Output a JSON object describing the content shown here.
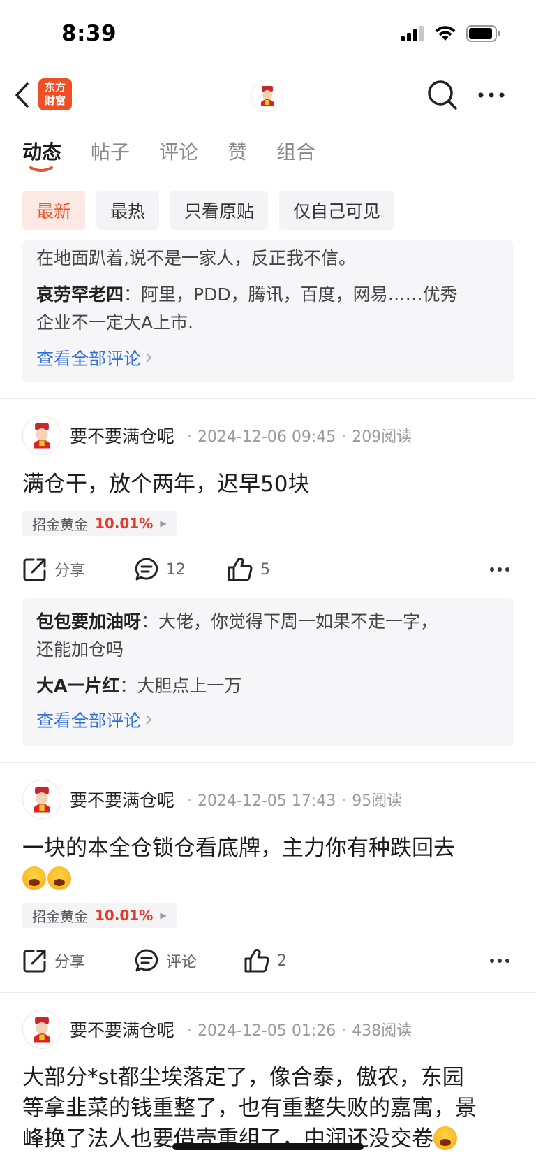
{
  "status_bar": {
    "time": "8:39"
  },
  "navbar": {
    "logo_text": "东方\n财富"
  },
  "tabs": [
    {
      "label": "动态"
    },
    {
      "label": "帖子"
    },
    {
      "label": "评论"
    },
    {
      "label": "赞"
    },
    {
      "label": "组合"
    }
  ],
  "filters": [
    {
      "label": "最新"
    },
    {
      "label": "最热"
    },
    {
      "label": "只看原贴"
    },
    {
      "label": "仅自己可见"
    }
  ],
  "top_comments": {
    "partial_line": "在地面趴着,说不是一家人，反正我不信。",
    "comment_author": "哀劳罕老四",
    "comment_text": "阿里，PDD，腾讯，百度，网易……优秀企业不一定大A上市.",
    "comment_text_line2": "企业不一定大A上市.",
    "view_all": "查看全部评论"
  },
  "posts": [
    {
      "user": "要不要满仓呢",
      "datetime": "2024-12-06 09:45",
      "reads": "209阅读",
      "body": "满仓干，放个两年，迟早50块",
      "stock_name": "招金黄金",
      "stock_pct": "10.01%",
      "share_label": "分享",
      "comment_label": "12",
      "like_count": "5",
      "comments": [
        {
          "author": "包包要加油呀",
          "text_l1": "大佬，你觉得下周一如果不走一字，",
          "text_l2": "还能加仓吗"
        },
        {
          "author": "大A一片红",
          "text_l1": "大胆点上一万"
        }
      ],
      "view_all": "查看全部评论"
    },
    {
      "user": "要不要满仓呢",
      "datetime": "2024-12-05 17:43",
      "reads": "95阅读",
      "body": "一块的本全仓锁仓看底牌，主力你有种跌回去",
      "stock_name": "招金黄金",
      "stock_pct": "10.01%",
      "share_label": "分享",
      "comment_label": "评论",
      "like_count": "2"
    },
    {
      "user": "要不要满仓呢",
      "datetime": "2024-12-05 01:26",
      "reads": "438阅读",
      "body_l1": "大部分*st都尘埃落定了，像合泰，傲农，东园",
      "body_l2": "等拿韭菜的钱重整了，也有重整失败的嘉寓，景",
      "body_l3": "峰换了法人也要借壳重组了，中润还没交卷"
    }
  ],
  "colors": {
    "accent": "#f04e23",
    "link": "#2f6fd6",
    "up": "#e53b2b"
  }
}
